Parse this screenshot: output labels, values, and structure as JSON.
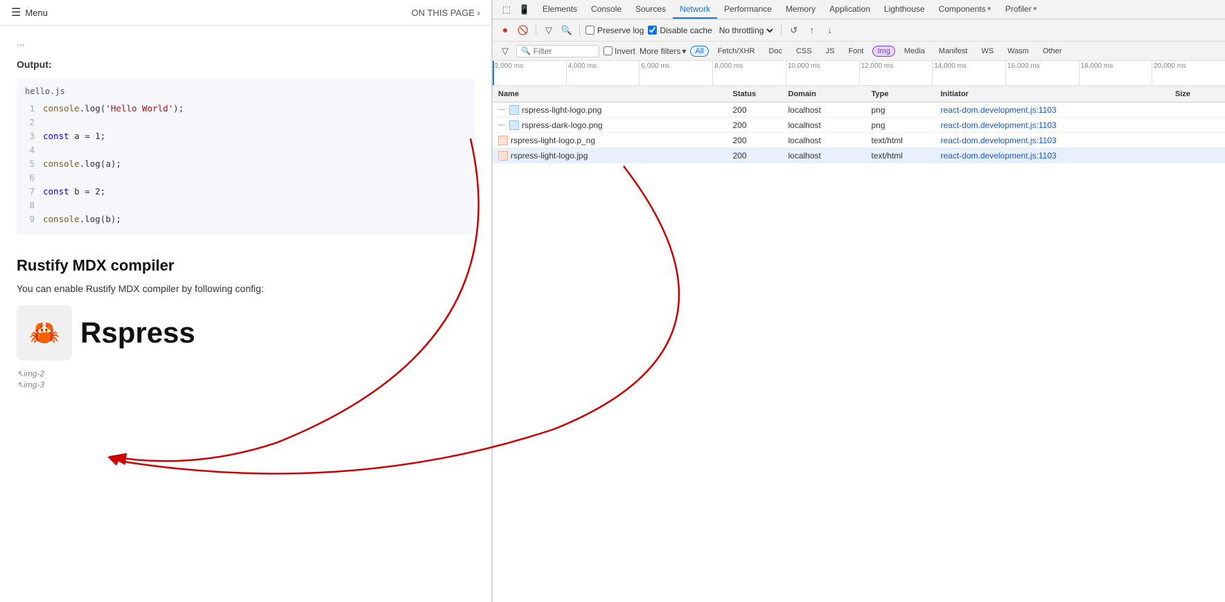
{
  "leftPanel": {
    "menu": "Menu",
    "onThisPage": "ON THIS PAGE",
    "ellipsis": "...",
    "outputLabel": "Output:",
    "codeBlock": {
      "filename": "hello.js",
      "lines": [
        {
          "num": 1,
          "code": "console.log('Hello World');",
          "type": "console"
        },
        {
          "num": 2,
          "code": ""
        },
        {
          "num": 3,
          "code": "const a = 1;",
          "type": "const"
        },
        {
          "num": 4,
          "code": ""
        },
        {
          "num": 5,
          "code": "console.log(a);",
          "type": "console"
        },
        {
          "num": 6,
          "code": ""
        },
        {
          "num": 7,
          "code": "const b = 2;",
          "type": "const"
        },
        {
          "num": 8,
          "code": ""
        },
        {
          "num": 9,
          "code": "console.log(b);",
          "type": "console"
        }
      ]
    },
    "sectionTitle": "Rustify MDX compiler",
    "sectionText": "You can enable Rustify MDX compiler by following config:",
    "rspressTitle": "Rspress",
    "img2": "img-2",
    "img3": "img-3"
  },
  "devtools": {
    "tabs": [
      {
        "label": "Elements",
        "active": false
      },
      {
        "label": "Console",
        "active": false
      },
      {
        "label": "Sources",
        "active": false
      },
      {
        "label": "Network",
        "active": true
      },
      {
        "label": "Performance",
        "active": false
      },
      {
        "label": "Memory",
        "active": false
      },
      {
        "label": "Application",
        "active": false
      },
      {
        "label": "Lighthouse",
        "active": false
      },
      {
        "label": "Components",
        "active": false,
        "badge": "●"
      },
      {
        "label": "Profiler",
        "active": false,
        "badge": "●"
      }
    ],
    "toolbar": {
      "preserveLog": "Preserve log",
      "disableCache": "Disable cache",
      "throttling": "No throttling"
    },
    "filterBar": {
      "placeholder": "Filter",
      "invertLabel": "Invert",
      "moreFilters": "More filters",
      "tags": [
        "All",
        "Fetch/XHR",
        "Doc",
        "CSS",
        "JS",
        "Font",
        "Img",
        "Media",
        "Manifest",
        "WS",
        "Wasm",
        "Other"
      ]
    },
    "timeline": {
      "ticks": [
        "2,000 ms",
        "4,000 ms",
        "6,000 ms",
        "8,000 ms",
        "10,000 ms",
        "12,000 ms",
        "14,000 ms",
        "16,000 ms",
        "18,000 ms",
        "20,000 ms"
      ]
    },
    "table": {
      "headers": [
        "Name",
        "Status",
        "Domain",
        "Type",
        "Initiator",
        "Size"
      ],
      "rows": [
        {
          "name": "rspress-light-logo.png",
          "status": "200",
          "domain": "localhost",
          "type": "png",
          "initiator": "react-dom.development.js:1103",
          "size": "",
          "iconType": "img",
          "selected": false
        },
        {
          "name": "rspress-dark-logo.png",
          "status": "200",
          "domain": "localhost",
          "type": "png",
          "initiator": "react-dom.development.js:1103",
          "size": "",
          "iconType": "img",
          "selected": false
        },
        {
          "name": "rspress-light-logo.p_ng",
          "status": "200",
          "domain": "localhost",
          "type": "text/html",
          "initiator": "react-dom.development.js:1103",
          "size": "",
          "iconType": "html",
          "selected": false
        },
        {
          "name": "rspress-light-logo.jpg",
          "status": "200",
          "domain": "localhost",
          "type": "text/html",
          "initiator": "react-dom.development.js:1103",
          "size": "",
          "iconType": "html",
          "selected": true
        }
      ]
    }
  }
}
